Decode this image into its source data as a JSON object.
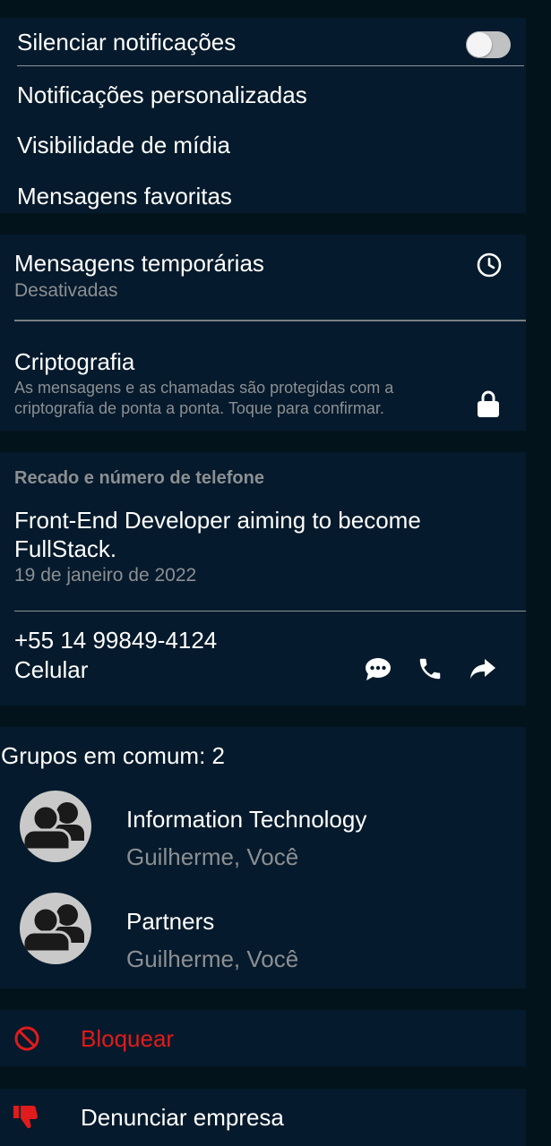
{
  "notifications": {
    "mute_label": "Silenciar notificações",
    "mute_on": false,
    "custom_label": "Notificações personalizadas",
    "media_visibility_label": "Visibilidade de mídia",
    "starred_label": "Mensagens favoritas"
  },
  "privacy": {
    "disappearing_label": "Mensagens temporárias",
    "disappearing_status": "Desativadas",
    "encryption_label": "Criptografia",
    "encryption_desc_line1": "As mensagens e as chamadas são protegidas com a",
    "encryption_desc_line2": "criptografia de ponta a ponta. Toque para confirmar."
  },
  "about": {
    "section_title": "Recado e número de telefone",
    "status_line1": "Front-End Developer aiming to become",
    "status_line2": "FullStack.",
    "status_date": "19 de janeiro de 2022",
    "phone": "+55 14 99849-4124",
    "phone_type": "Celular"
  },
  "groups": {
    "header": "Grupos em comum: 2",
    "items": [
      {
        "name": "Information Technology",
        "members": "Guilherme, Você"
      },
      {
        "name": "Partners",
        "members": "Guilherme, Você"
      }
    ]
  },
  "actions": {
    "block_label": "Bloquear",
    "report_label": "Denunciar empresa"
  },
  "icons": {
    "clock": "clock-icon",
    "lock": "lock-icon",
    "message": "message-icon",
    "call": "phone-icon",
    "share": "share-icon",
    "group": "group-avatar-icon",
    "block": "block-icon",
    "report": "thumbs-down-icon"
  },
  "colors": {
    "panel": "#051a2c",
    "background": "#03131c",
    "danger": "#e01b1b",
    "secondary_text": "#8c8f92"
  }
}
